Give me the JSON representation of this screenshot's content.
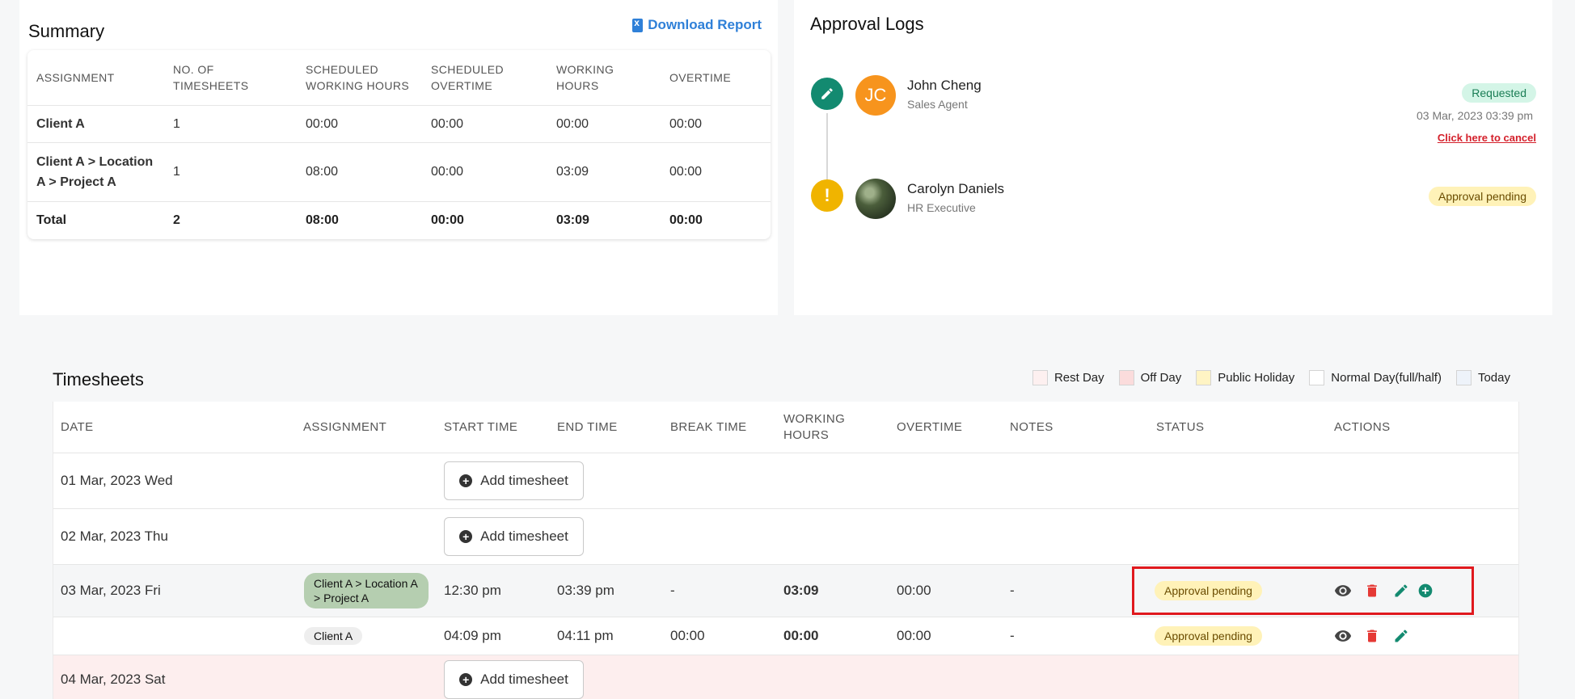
{
  "summary": {
    "title": "Summary",
    "download_label": "Download Report",
    "headers": [
      "ASSIGNMENT",
      "NO. OF TIMESHEETS",
      "SCHEDULED WORKING HOURS",
      "SCHEDULED OVERTIME",
      "WORKING HOURS",
      "OVERTIME"
    ],
    "rows": [
      [
        "Client A",
        "1",
        "00:00",
        "00:00",
        "00:00",
        "00:00"
      ],
      [
        "Client A > Location A > Project A",
        "1",
        "08:00",
        "00:00",
        "03:09",
        "00:00"
      ],
      [
        "Total",
        "2",
        "08:00",
        "00:00",
        "03:09",
        "00:00"
      ]
    ]
  },
  "approval": {
    "title": "Approval Logs",
    "logs": [
      {
        "initials": "JC",
        "name": "John Cheng",
        "role": "Sales Agent",
        "status": "Requested",
        "time": "03 Mar, 2023 03:39 pm",
        "cancel": "Click here to cancel"
      },
      {
        "name": "Carolyn Daniels",
        "role": "HR Executive",
        "status": "Approval pending"
      }
    ]
  },
  "timesheets": {
    "title": "Timesheets",
    "legend": [
      "Rest Day",
      "Off Day",
      "Public Holiday",
      "Normal Day(full/half)",
      "Today"
    ],
    "legend_colors": [
      "#fdf0f0",
      "#fbdcdc",
      "#fff4c4",
      "#ffffff",
      "#eef3fa"
    ],
    "headers": [
      "DATE",
      "ASSIGNMENT",
      "START TIME",
      "END TIME",
      "BREAK TIME",
      "WORKING HOURS",
      "OVERTIME",
      "NOTES",
      "STATUS",
      "ACTIONS"
    ],
    "add_label": "Add timesheet",
    "rows": [
      {
        "date": "01 Mar, 2023 Wed"
      },
      {
        "date": "02 Mar, 2023 Thu"
      },
      {
        "date": "03 Mar, 2023 Fri",
        "assignment": "Client A > Location A > Project A",
        "start": "12:30 pm",
        "end": "03:39 pm",
        "break": "-",
        "working": "03:09",
        "overtime": "00:00",
        "notes": "-",
        "status": "Approval pending"
      },
      {
        "date": "",
        "assignment": "Client A",
        "start": "04:09 pm",
        "end": "04:11 pm",
        "break": "00:00",
        "working": "00:00",
        "overtime": "00:00",
        "notes": "-",
        "status": "Approval pending"
      },
      {
        "date": "04 Mar, 2023 Sat"
      }
    ]
  },
  "colors": {
    "accent_green": "#138a70",
    "delete_red": "#e53935",
    "link_blue": "#2f80d8",
    "pending_yellow": "#f0b400",
    "highlight_red": "#e0191e"
  }
}
